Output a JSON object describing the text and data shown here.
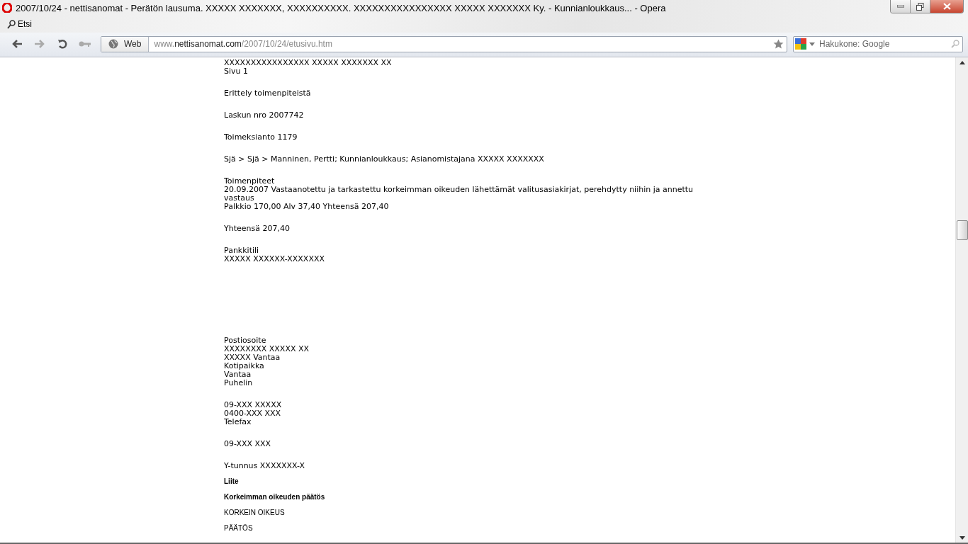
{
  "window": {
    "title": "2007/10/24 - nettisanomat - Perätön lausuma. XXXXX XXXXXXX, XXXXXXXXXX. XXXXXXXXXXXXXXXX XXXXX XXXXXXX Ky. - Kunnianloukkaus... - Opera"
  },
  "menu": {
    "label": "Etsi"
  },
  "toolbar": {
    "address_tab": "Web",
    "url": {
      "prefix": "www.",
      "domain": "nettisanomat.com",
      "path": "/2007/10/24/etusivu.htm"
    },
    "search": {
      "placeholder": "Hakukone: Google"
    }
  },
  "document": {
    "blocks": [
      {
        "kind": "text",
        "lines": [
          "XXXXXXXXXXXXXXXX XXXXX XXXXXXX XX",
          "Sivu 1"
        ]
      },
      {
        "kind": "text",
        "lines": [
          "Erittely toimenpiteistä"
        ]
      },
      {
        "kind": "text",
        "lines": [
          "Laskun nro 2007742"
        ]
      },
      {
        "kind": "text",
        "lines": [
          "Toimeksianto 1179"
        ]
      },
      {
        "kind": "text",
        "lines": [
          "Sjä > Sjä > Manninen, Pertti; Kunnianloukkaus; Asianomistajana XXXXX XXXXXXX"
        ]
      },
      {
        "kind": "text",
        "lines": [
          "Toimenpiteet",
          "20.09.2007 Vastaanotettu ja tarkastettu korkeimman oikeuden lähettämät valitusasiakirjat, perehdytty niihin ja annettu vastaus",
          "Palkkio 170,00 Alv 37,40 Yhteensä 207,40"
        ]
      },
      {
        "kind": "text",
        "lines": [
          "Yhteensä 207,40"
        ]
      },
      {
        "kind": "text",
        "lines": [
          "Pankkitili",
          "XXXXX XXXXXX-XXXXXXX"
        ]
      },
      {
        "kind": "text",
        "lines": [
          "Postiosoite",
          "XXXXXXXX XXXXX XX",
          "XXXXX Vantaa",
          "Kotipaikka",
          "Vantaa",
          "Puhelin"
        ]
      },
      {
        "kind": "text",
        "lines": [
          "09-XXX XXXXX",
          "0400-XXX XXX",
          "Telefax"
        ]
      },
      {
        "kind": "text",
        "lines": [
          "09-XXX XXX"
        ]
      },
      {
        "kind": "text",
        "lines": [
          "Y-tunnus XXXXXXX-X"
        ]
      },
      {
        "kind": "bold",
        "lines": [
          "Liite"
        ]
      },
      {
        "kind": "bold",
        "lines": [
          "Korkeimman oikeuden päätös"
        ]
      },
      {
        "kind": "plain",
        "lines": [
          "KORKEIN OIKEUS"
        ]
      },
      {
        "kind": "plain",
        "lines": [
          "PÄÄTÖS"
        ]
      }
    ]
  }
}
